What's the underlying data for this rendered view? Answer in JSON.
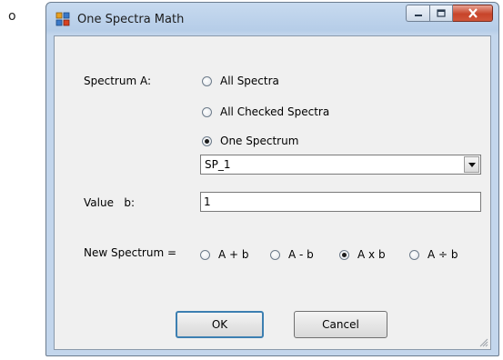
{
  "page": {
    "bullet": "o"
  },
  "window": {
    "title": "One Spectra Math",
    "caption_buttons": [
      "minimize",
      "maximize",
      "close"
    ]
  },
  "form": {
    "spectrum_label": "Spectrum A:",
    "spectrum_options": [
      {
        "label": "All Spectra",
        "selected": false
      },
      {
        "label": "All Checked Spectra",
        "selected": false
      },
      {
        "label": "One Spectrum",
        "selected": true
      }
    ],
    "spectrum_select_value": "SP_1",
    "value_label": "Value   b:",
    "value_input": "1",
    "new_spectrum_label": "New Spectrum =",
    "operations": [
      {
        "label": "A + b",
        "selected": false
      },
      {
        "label": "A - b",
        "selected": false
      },
      {
        "label": "A x b",
        "selected": true
      },
      {
        "label": "A ÷ b",
        "selected": false
      }
    ]
  },
  "buttons": {
    "ok": "OK",
    "cancel": "Cancel"
  }
}
